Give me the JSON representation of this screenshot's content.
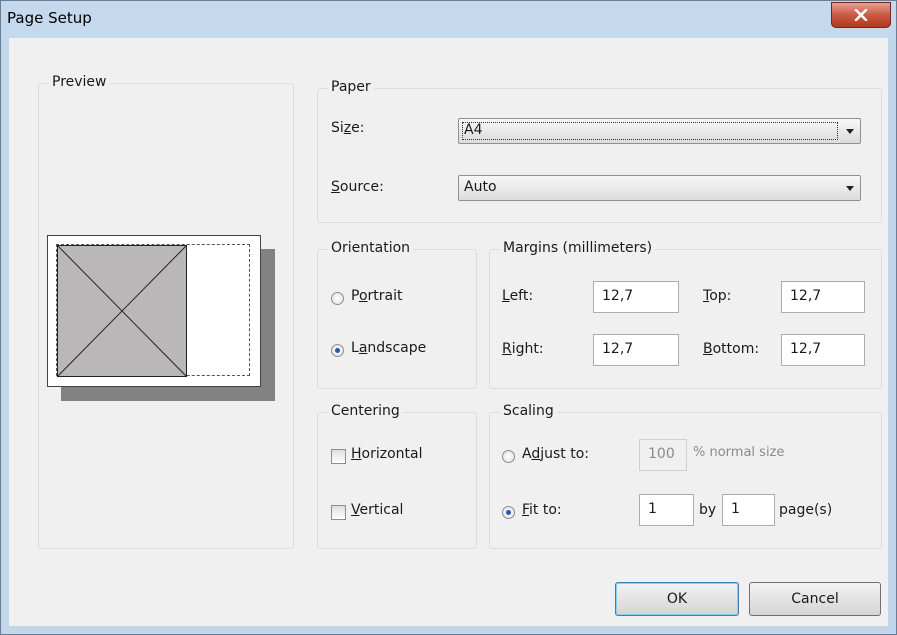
{
  "window": {
    "title": "Page Setup"
  },
  "preview": {
    "legend": "Preview"
  },
  "paper": {
    "legend": "Paper",
    "size_label": "Size:",
    "size_value": "A4",
    "source_label": "Source:",
    "source_value": "Auto"
  },
  "orientation": {
    "legend": "Orientation",
    "portrait": "Portrait",
    "landscape": "Landscape",
    "selected": "Landscape"
  },
  "margins": {
    "legend": "Margins (millimeters)",
    "left_label": "Left:",
    "left_value": "12,7",
    "top_label": "Top:",
    "top_value": "12,7",
    "right_label": "Right:",
    "right_value": "12,7",
    "bottom_label": "Bottom:",
    "bottom_value": "12,7"
  },
  "centering": {
    "legend": "Centering",
    "horizontal": "Horizontal",
    "vertical": "Vertical"
  },
  "scaling": {
    "legend": "Scaling",
    "adjust_label": "Adjust to:",
    "adjust_value": "100",
    "adjust_suffix": "% normal size",
    "fit_label": "Fit to:",
    "fit_pages_wide": "1",
    "by": "by",
    "fit_pages_tall": "1",
    "pages_suffix": "page(s)",
    "selected": "Fit to:"
  },
  "buttons": {
    "ok": "OK",
    "cancel": "Cancel"
  }
}
